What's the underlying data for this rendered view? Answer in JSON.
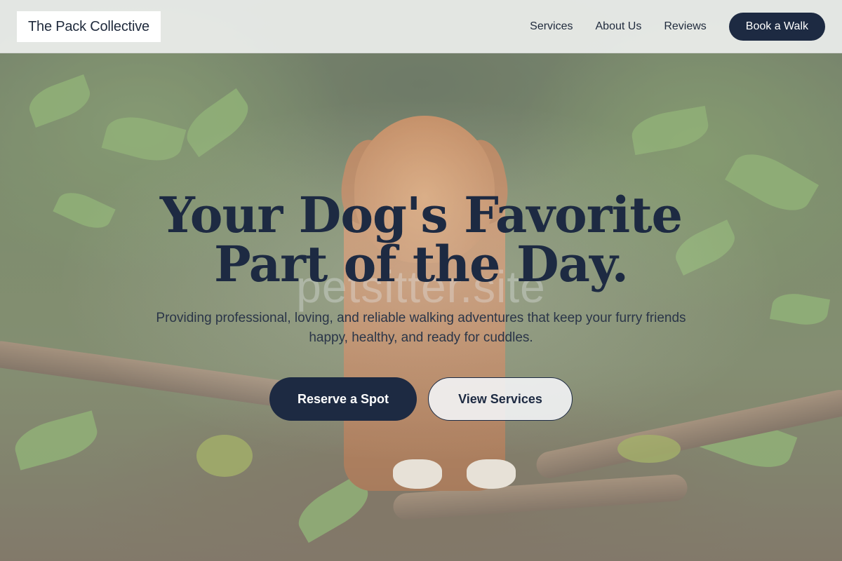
{
  "header": {
    "brand": "The Pack Collective",
    "nav": [
      {
        "label": "Services"
      },
      {
        "label": "About Us"
      },
      {
        "label": "Reviews"
      }
    ],
    "cta_label": "Book a Walk"
  },
  "hero": {
    "title": "Your Dog's Favorite Part of the Day.",
    "watermark": "petsitter.site",
    "subtitle": "Providing professional, loving, and reliable walking adventures that keep your furry friends happy, healthy, and ready for cuddles.",
    "primary_button": "Reserve a Spot",
    "secondary_button": "View Services"
  },
  "colors": {
    "primary": "#1d2a42",
    "header_bg": "#eceeec",
    "secondary_button_bg": "#f3f4f6"
  }
}
